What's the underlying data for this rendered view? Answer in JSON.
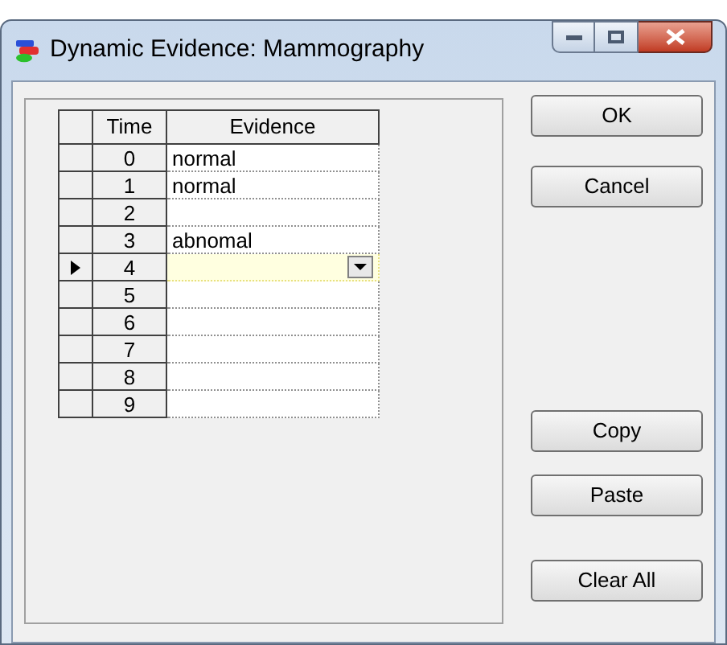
{
  "window": {
    "title": "Dynamic Evidence: Mammography"
  },
  "table": {
    "columns": [
      "Time",
      "Evidence"
    ],
    "rows": [
      {
        "time": "0",
        "evidence": "normal",
        "selected": false
      },
      {
        "time": "1",
        "evidence": "normal",
        "selected": false
      },
      {
        "time": "2",
        "evidence": "",
        "selected": false
      },
      {
        "time": "3",
        "evidence": "abnomal",
        "selected": false
      },
      {
        "time": "4",
        "evidence": "",
        "selected": true
      },
      {
        "time": "5",
        "evidence": "",
        "selected": false
      },
      {
        "time": "6",
        "evidence": "",
        "selected": false
      },
      {
        "time": "7",
        "evidence": "",
        "selected": false
      },
      {
        "time": "8",
        "evidence": "",
        "selected": false
      },
      {
        "time": "9",
        "evidence": "",
        "selected": false
      }
    ]
  },
  "buttons_top": [
    "OK",
    "Cancel"
  ],
  "buttons_bottom": [
    "Copy",
    "Paste"
  ],
  "clear_button": "Clear All"
}
